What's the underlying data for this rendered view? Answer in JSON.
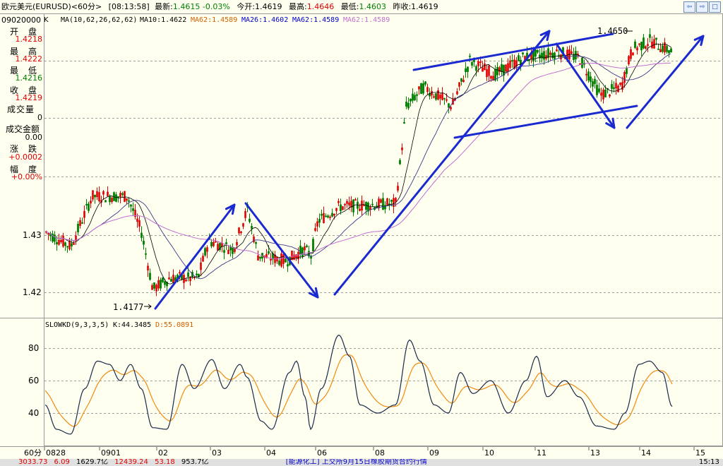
{
  "header": {
    "instrument": "欧元美元(EURUSD)<60分>",
    "time": "[08:13:58]",
    "latest_label": "最新:",
    "latest_value": "1.4615 -0.03%",
    "open_label": "今开:",
    "open_value": "1.4619",
    "high_label": "最高:",
    "high_value": "1.4646",
    "low_label": "最低:",
    "low_value": "1.4603",
    "prev_label": "昨收:",
    "prev_value": "1.4619",
    "buttons": [
      "⇦",
      "⇨",
      "□"
    ]
  },
  "ma_legend": {
    "prefix": "MA(10,62,26,62,62)",
    "ma10": "MA10:1.4622",
    "ma62a": "MA62:1.4589",
    "ma26": "MA26:1.4602",
    "ma62b": "MA62:1.4589",
    "ma62c": "MA62:1.4589"
  },
  "sidebar": {
    "date": "09020000",
    "date_suffix": "K",
    "rows": [
      {
        "label": "开　盘",
        "value": "1.4218"
      },
      {
        "label": "最　高",
        "value": "1.4222"
      },
      {
        "label": "最　低",
        "value": "1.4216"
      },
      {
        "label": "收　盘",
        "value": "1.4219"
      },
      {
        "label": "成交量",
        "value": "0"
      },
      {
        "label": "成交金额",
        "value": "0.00"
      },
      {
        "label": "涨　跌",
        "value": "+0.0002"
      },
      {
        "label": "幅　度",
        "value": "+0.00%"
      }
    ],
    "price_ticks": [
      "1.43",
      "1.42"
    ],
    "kd_ticks": [
      "80",
      "60",
      "40"
    ],
    "period": "60分"
  },
  "annotations": {
    "high_mark": "1.4650",
    "low_mark": "1.4177"
  },
  "kd_legend": {
    "prefix": "SLOWKD(9,3,3,5)",
    "k": "K:44.3485",
    "d": "D:55.0891"
  },
  "x_axis": [
    "0828",
    "0901",
    "02",
    "03",
    "04",
    "06",
    "08",
    "09",
    "10",
    "11",
    "13",
    "14",
    "15"
  ],
  "statusbar": {
    "left_values": [
      "3033.73",
      "6.09",
      "1629.7亿",
      "12439.24",
      "53.18",
      "953.7亿"
    ],
    "news": "[能源化工] 上交所9月15日橡胶期货合约行情",
    "time": "15:13"
  },
  "colors": {
    "up": "#e00000",
    "down": "#008000",
    "ma10": "#000000",
    "ma26": "#3a3a8a",
    "ma62": "#c070d0",
    "arrow": "#1a2ad0",
    "k_line": "#1a2a4a",
    "d_line": "#f08a10",
    "background": "#fffff0"
  }
}
